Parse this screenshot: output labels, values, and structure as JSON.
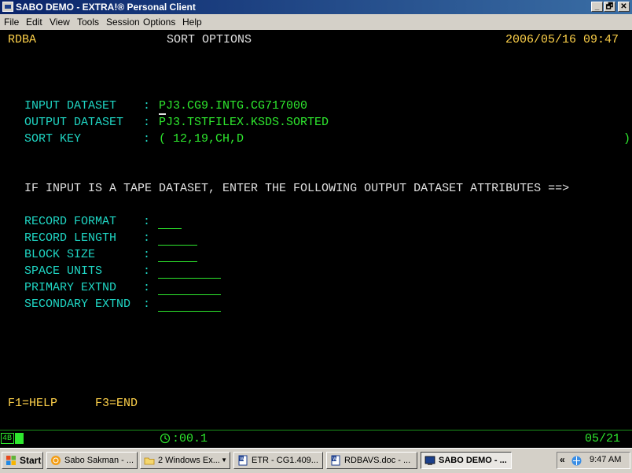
{
  "window": {
    "title": "SABO DEMO - EXTRA!® Personal Client",
    "menu": [
      "File",
      "Edit",
      "View",
      "Tools",
      "Session",
      "Options",
      "Help"
    ],
    "controls": {
      "minimize": "_",
      "restore": "🗗",
      "close": "✕"
    }
  },
  "screen": {
    "system_id": "RDBA",
    "title": "SORT OPTIONS",
    "datetime": "2006/05/16 09:47",
    "input_label": "INPUT DATASET",
    "input_value": "PJ3.CG9.INTG.CG717000",
    "output_label": "OUTPUT DATASET",
    "output_value": "PJ3.TSTFILEX.KSDS.SORTED",
    "sortkey_label": "SORT KEY",
    "sortkey_value": "( 12,19,CH,D",
    "sortkey_close": ")",
    "colon": ":",
    "tape_instruction": "IF INPUT IS A TAPE DATASET, ENTER THE FOLLOWING OUTPUT DATASET ATTRIBUTES ==>",
    "attributes": [
      {
        "label": "RECORD FORMAT",
        "colon": ":",
        "value": ""
      },
      {
        "label": "RECORD LENGTH",
        "colon": ":",
        "value": ""
      },
      {
        "label": "BLOCK SIZE",
        "colon": ":",
        "value": ""
      },
      {
        "label": "SPACE UNITS",
        "colon": ":",
        "value": ""
      },
      {
        "label": "PRIMARY EXTND",
        "colon": ":",
        "value": ""
      },
      {
        "label": "SECONDARY EXTND",
        "colon": ":",
        "value": ""
      }
    ],
    "pf_keys": [
      "F1=HELP",
      "F3=END"
    ]
  },
  "status": {
    "indicator": "4B",
    "timer": ":00.1",
    "cursor_position": "05/21"
  },
  "taskbar": {
    "start": "Start",
    "items": [
      {
        "label": "Sabo Sakman - ...",
        "icon": "browser-icon"
      },
      {
        "label": "2 Windows Ex...",
        "icon": "folder-icon"
      },
      {
        "label": "ETR - CG1.409...",
        "icon": "word-document-icon"
      },
      {
        "label": "RDBAVS.doc - ...",
        "icon": "word-document-icon"
      },
      {
        "label": "SABO DEMO - ...",
        "icon": "terminal-icon",
        "active": true
      }
    ],
    "tray_chevron": "«",
    "clock": "9:47 AM"
  }
}
